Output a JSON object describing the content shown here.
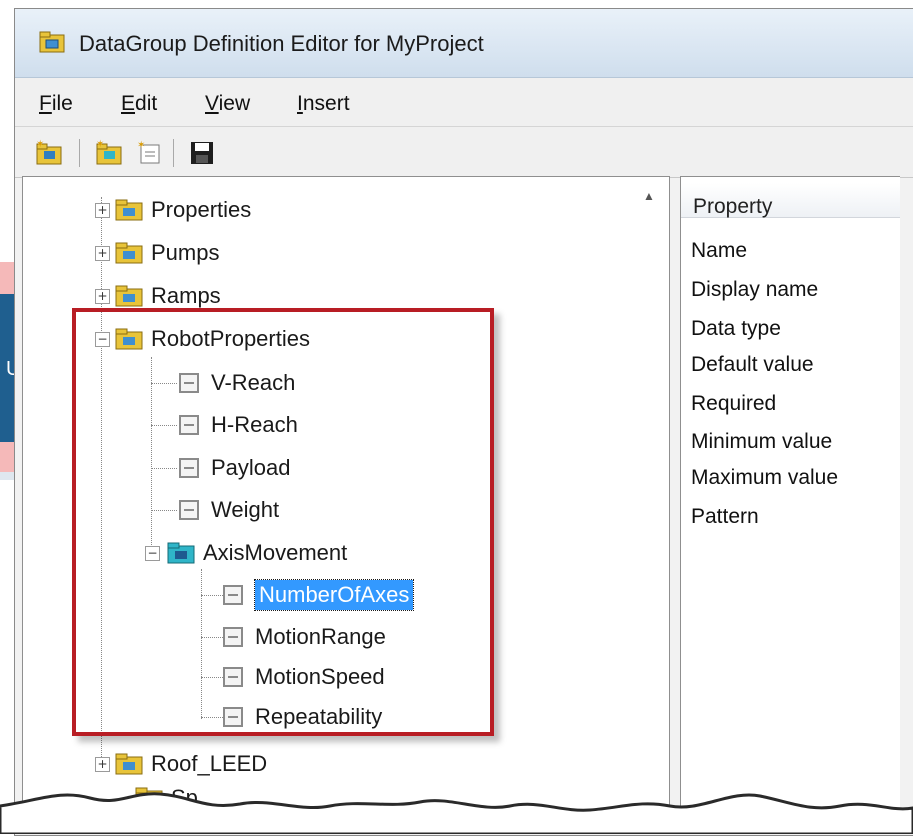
{
  "banner": {
    "text": "Us"
  },
  "window": {
    "title": "DataGroup Definition Editor for MyProject",
    "title_icon": "folder-group-icon"
  },
  "menu": [
    {
      "label": "ile",
      "mnemonic": "F"
    },
    {
      "label": "dit",
      "mnemonic": "E"
    },
    {
      "label": "iew",
      "mnemonic": "V"
    },
    {
      "label": "nsert",
      "mnemonic": "I"
    }
  ],
  "toolbar": {
    "buttons": [
      "new-group-icon",
      "new-subgroup-icon",
      "new-property-icon",
      "save-icon"
    ]
  },
  "tree": {
    "nodes": [
      {
        "label": "Properties",
        "type": "group",
        "expanded": false
      },
      {
        "label": "Pumps",
        "type": "group",
        "expanded": false
      },
      {
        "label": "Ramps",
        "type": "group",
        "expanded": false
      },
      {
        "label": "RobotProperties",
        "type": "group",
        "expanded": true
      },
      {
        "label": "V-Reach",
        "type": "property"
      },
      {
        "label": "H-Reach",
        "type": "property"
      },
      {
        "label": "Payload",
        "type": "property"
      },
      {
        "label": "Weight",
        "type": "property"
      },
      {
        "label": "AxisMovement",
        "type": "subgroup",
        "expanded": true
      },
      {
        "label": "NumberOfAxes",
        "type": "property",
        "selected": true
      },
      {
        "label": "MotionRange",
        "type": "property"
      },
      {
        "label": "MotionSpeed",
        "type": "property"
      },
      {
        "label": "Repeatability",
        "type": "property"
      },
      {
        "label": "Roof_LEED",
        "type": "group",
        "expanded": false
      },
      {
        "label": "Sp",
        "type": "group",
        "expanded": false
      }
    ]
  },
  "properties_panel": {
    "header": "Property",
    "rows": [
      "Name",
      "Display name",
      "Data type",
      "Default value",
      "Required",
      "Minimum value",
      "Maximum value",
      "Pattern"
    ]
  },
  "colors": {
    "highlight_box": "#b81d24",
    "selection": "#3399ff",
    "folder": "#e8c43a",
    "subgroup_folder": "#2fb5c8"
  }
}
